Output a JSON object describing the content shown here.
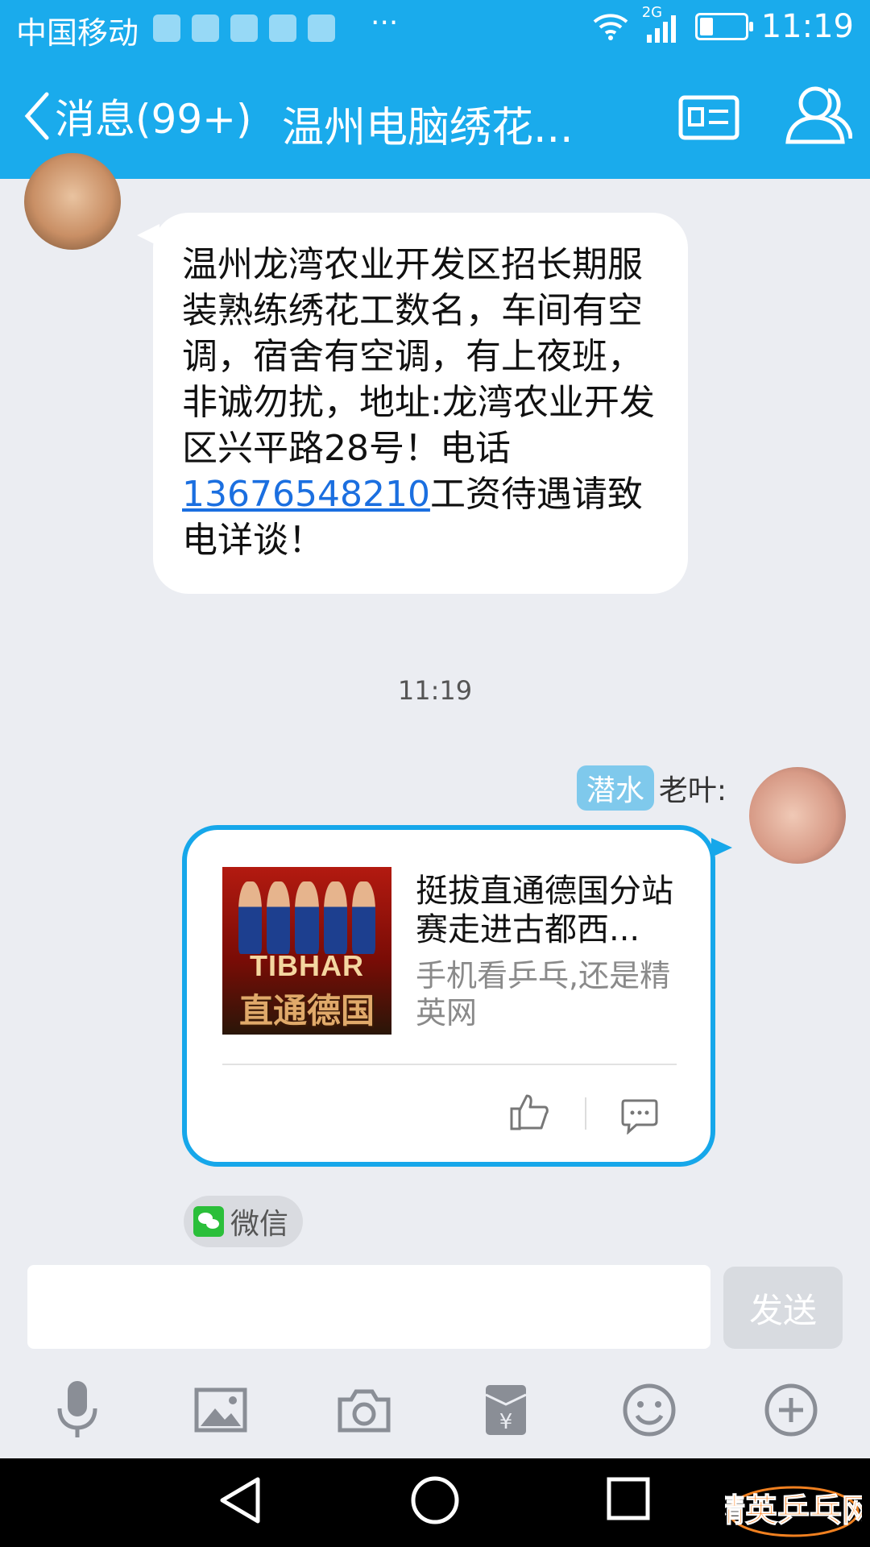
{
  "status_bar": {
    "carrier": "中国移动",
    "more": "···",
    "network": "2G",
    "time": "11:19",
    "battery_level": 0.3
  },
  "title_bar": {
    "back_label": "消息(99+)",
    "title": "温州电脑绣花...",
    "accent_color": "#1aabec"
  },
  "messages": {
    "incoming": {
      "text_before_link": "温州龙湾农业开发区招长期服装熟练绣花工数名，车间有空调，宿舍有空调，有上夜班，非诚勿扰，地址:龙湾农业开发区兴平路28号！电话",
      "phone": "13676548210",
      "text_after_link": "工资待遇请致电详谈！"
    },
    "timestamp": "11:19",
    "outgoing": {
      "sender_tag": "潜水",
      "sender_name": "老叶:",
      "share_image_brand": "TIBHAR",
      "share_image_subtitle": "直通德国",
      "share_title": "挺拔直通德国分站赛走进古都西...",
      "share_desc": "手机看乒乓,还是精英网",
      "source": "微信"
    }
  },
  "input_bar": {
    "input_value": "",
    "send_label": "发送"
  },
  "toolbar": [
    "microphone-icon",
    "image-icon",
    "camera-icon",
    "red-packet-icon",
    "emoji-icon",
    "plus-icon"
  ],
  "watermark_text": "精英乒乓网"
}
